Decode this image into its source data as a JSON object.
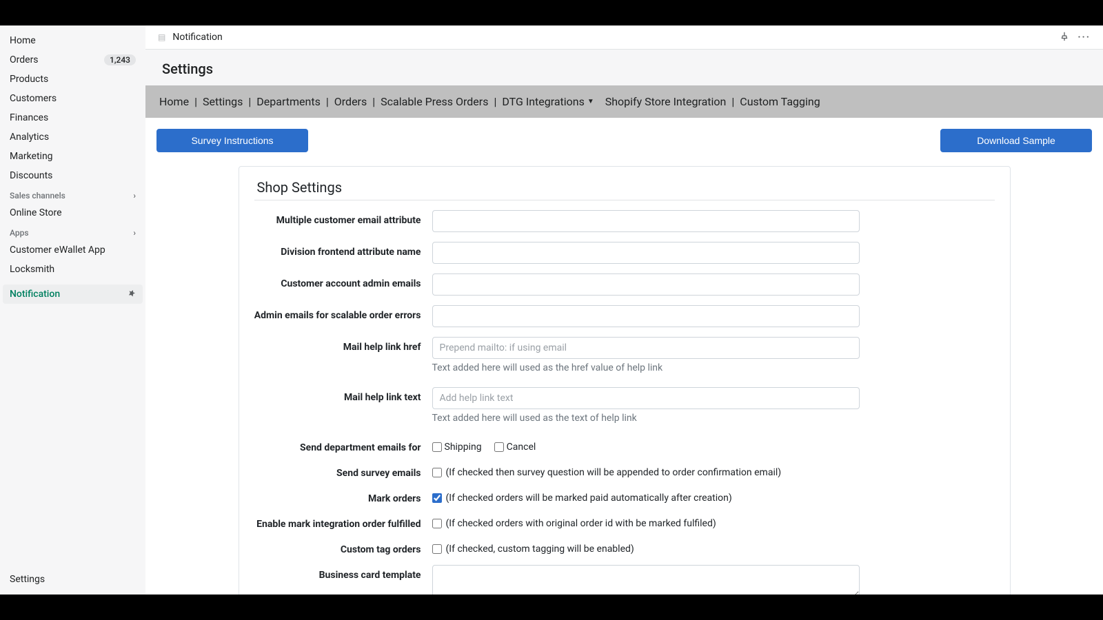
{
  "topbar": {
    "icon_label": "app-icon",
    "title": "Notification"
  },
  "sidebar": {
    "nav": [
      {
        "label": "Home",
        "badge": null
      },
      {
        "label": "Orders",
        "badge": "1,243"
      },
      {
        "label": "Products",
        "badge": null
      },
      {
        "label": "Customers",
        "badge": null
      },
      {
        "label": "Finances",
        "badge": null
      },
      {
        "label": "Analytics",
        "badge": null
      },
      {
        "label": "Marketing",
        "badge": null
      },
      {
        "label": "Discounts",
        "badge": null
      }
    ],
    "sales_channels_header": "Sales channels",
    "sales_channels": [
      {
        "label": "Online Store"
      }
    ],
    "apps_header": "Apps",
    "apps": [
      {
        "label": "Customer eWallet App"
      },
      {
        "label": "Locksmith"
      }
    ],
    "pinned": {
      "label": "Notification"
    },
    "footer": {
      "label": "Settings"
    }
  },
  "page": {
    "title": "Settings",
    "tabs": [
      "Home",
      "Settings",
      "Departments",
      "Orders",
      "Scalable Press Orders",
      "DTG Integrations",
      "Shopify Store Integration",
      "Custom Tagging"
    ],
    "buttons": {
      "survey": "Survey Instructions",
      "download": "Download Sample"
    }
  },
  "form": {
    "card_title": "Shop Settings",
    "fields": {
      "multi_email": {
        "label": "Multiple customer email attribute",
        "value": ""
      },
      "division_attr": {
        "label": "Division frontend attribute name",
        "value": ""
      },
      "admin_emails": {
        "label": "Customer account admin emails",
        "value": ""
      },
      "scalable_errors": {
        "label": "Admin emails for scalable order errors",
        "value": ""
      },
      "help_href": {
        "label": "Mail help link href",
        "placeholder": "Prepend mailto: if using email",
        "help": "Text added here will used as the href value of help link"
      },
      "help_text": {
        "label": "Mail help link text",
        "placeholder": "Add help link text",
        "help": "Text added here will used as the text of help link"
      },
      "dept_emails": {
        "label": "Send department emails for",
        "opt1": "Shipping",
        "opt2": "Cancel"
      },
      "survey_emails": {
        "label": "Send survey emails",
        "desc": "(If checked then survey question will be appended to order confirmation email)"
      },
      "mark_orders": {
        "label": "Mark orders",
        "desc": "(If checked orders will be marked paid automatically after creation)",
        "checked": true
      },
      "mark_fulfilled": {
        "label": "Enable mark integration order fulfilled",
        "desc": "(If checked orders with original order id with be marked fulfiled)"
      },
      "custom_tag": {
        "label": "Custom tag orders",
        "desc": "(If checked, custom tagging will be enabled)"
      },
      "biz_card": {
        "label": "Business card template",
        "value": ""
      }
    }
  }
}
